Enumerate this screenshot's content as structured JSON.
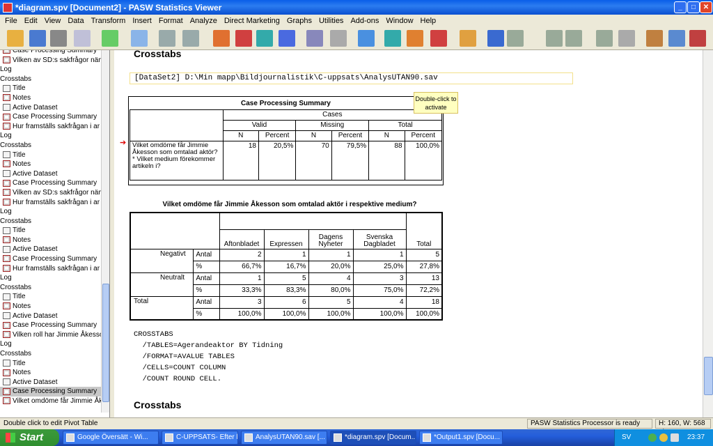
{
  "window": {
    "title": "*diagram.spv [Document2] - PASW Statistics Viewer"
  },
  "menu": [
    "File",
    "Edit",
    "View",
    "Data",
    "Transform",
    "Insert",
    "Format",
    "Analyze",
    "Direct Marketing",
    "Graphs",
    "Utilities",
    "Add-ons",
    "Window",
    "Help"
  ],
  "outline": [
    {
      "label": "Case Processing Summary",
      "icon": "table"
    },
    {
      "label": "Vilken av SD:s sakfrågor näm",
      "icon": "table"
    },
    {
      "label": "Log",
      "icon": "none"
    },
    {
      "label": "Crosstabs",
      "icon": "none"
    },
    {
      "label": "Title",
      "icon": "doc"
    },
    {
      "label": "Notes",
      "icon": "table"
    },
    {
      "label": "Active Dataset",
      "icon": "doc"
    },
    {
      "label": "Case Processing Summary",
      "icon": "table"
    },
    {
      "label": "Hur framställs sakfrågan i ar",
      "icon": "table"
    },
    {
      "label": "Log",
      "icon": "none"
    },
    {
      "label": "Crosstabs",
      "icon": "none"
    },
    {
      "label": "Title",
      "icon": "doc"
    },
    {
      "label": "Notes",
      "icon": "table"
    },
    {
      "label": "Active Dataset",
      "icon": "doc"
    },
    {
      "label": "Case Processing Summary",
      "icon": "table"
    },
    {
      "label": "Vilken av SD:s sakfrågor näm",
      "icon": "table"
    },
    {
      "label": "Hur framställs sakfrågan i ar",
      "icon": "table"
    },
    {
      "label": "Log",
      "icon": "none"
    },
    {
      "label": "Crosstabs",
      "icon": "none"
    },
    {
      "label": "Title",
      "icon": "doc"
    },
    {
      "label": "Notes",
      "icon": "table"
    },
    {
      "label": "Active Dataset",
      "icon": "doc"
    },
    {
      "label": "Case Processing Summary",
      "icon": "table"
    },
    {
      "label": "Hur framställs sakfrågan i ar",
      "icon": "table"
    },
    {
      "label": "Log",
      "icon": "none"
    },
    {
      "label": "Crosstabs",
      "icon": "none"
    },
    {
      "label": "Title",
      "icon": "doc"
    },
    {
      "label": "Notes",
      "icon": "table"
    },
    {
      "label": "Active Dataset",
      "icon": "doc"
    },
    {
      "label": "Case Processing Summary",
      "icon": "table"
    },
    {
      "label": "Vilken roll har Jimmie Åkesso",
      "icon": "table"
    },
    {
      "label": "Log",
      "icon": "none"
    },
    {
      "label": "Crosstabs",
      "icon": "none"
    },
    {
      "label": "Title",
      "icon": "doc"
    },
    {
      "label": "Notes",
      "icon": "table"
    },
    {
      "label": "Active Dataset",
      "icon": "doc"
    },
    {
      "label": "Case Processing Summary",
      "icon": "table",
      "selected": true
    },
    {
      "label": "Vilket omdöme får Jimmie Åk",
      "icon": "table"
    }
  ],
  "content": {
    "heading_top": "Crosstabs",
    "dataset": "[DataSet2] D:\\Min mapp\\Bildjournalistik\\C-uppsats\\AnalysUTAN90.sav",
    "tooltip": "Double-click to activate",
    "cps": {
      "title": "Case Processing Summary",
      "cases": "Cases",
      "groups": [
        "Valid",
        "Missing",
        "Total"
      ],
      "sub": [
        "N",
        "Percent",
        "N",
        "Percent",
        "N",
        "Percent"
      ],
      "row_label": "Vilket omdöme får Jimmie Åkesson som omtalad aktör? * Vilket medium förekommer artikeln i?",
      "values": [
        "18",
        "20,5%",
        "70",
        "79,5%",
        "88",
        "100,0%"
      ]
    },
    "crosstab": {
      "title": "Vilket omdöme får Jimmie Åkesson som omtalad aktör i respektive medium?",
      "columns": [
        "Aftonbladet",
        "Expressen",
        "Dagens Nyheter",
        "Svenska Dagbladet",
        "Total"
      ],
      "rows": [
        {
          "group": "Negativt",
          "stat": "Antal",
          "values": [
            "2",
            "1",
            "1",
            "1",
            "5"
          ]
        },
        {
          "group": "",
          "stat": "%",
          "values": [
            "66,7%",
            "16,7%",
            "20,0%",
            "25,0%",
            "27,8%"
          ]
        },
        {
          "group": "Neutralt",
          "stat": "Antal",
          "values": [
            "1",
            "5",
            "4",
            "3",
            "13"
          ]
        },
        {
          "group": "",
          "stat": "%",
          "values": [
            "33,3%",
            "83,3%",
            "80,0%",
            "75,0%",
            "72,2%"
          ]
        },
        {
          "group": "Total",
          "stat": "Antal",
          "values": [
            "3",
            "6",
            "5",
            "4",
            "18"
          ]
        },
        {
          "group": "",
          "stat": "%",
          "values": [
            "100,0%",
            "100,0%",
            "100,0%",
            "100,0%",
            "100,0%"
          ]
        }
      ]
    },
    "syntax": [
      "CROSSTABS",
      "  /TABLES=Agerandeaktor BY Tidning",
      "  /FORMAT=AVALUE TABLES",
      "  /CELLS=COUNT COLUMN",
      "  /COUNT ROUND CELL."
    ],
    "heading_bottom": "Crosstabs"
  },
  "status": {
    "left": "Double click to edit Pivot Table",
    "processor": "PASW Statistics Processor is ready",
    "dims": "H: 160, W: 568 pt."
  },
  "taskbar": {
    "start": "Start",
    "tasks": [
      "Google Översätt - Wi...",
      "C-UPPSATS- Efter ha...",
      "AnalysUTAN90.sav [...",
      "*diagram.spv [Docum...",
      "*Output1.spv [Docu..."
    ],
    "lang": "SV",
    "clock": "23:37"
  }
}
